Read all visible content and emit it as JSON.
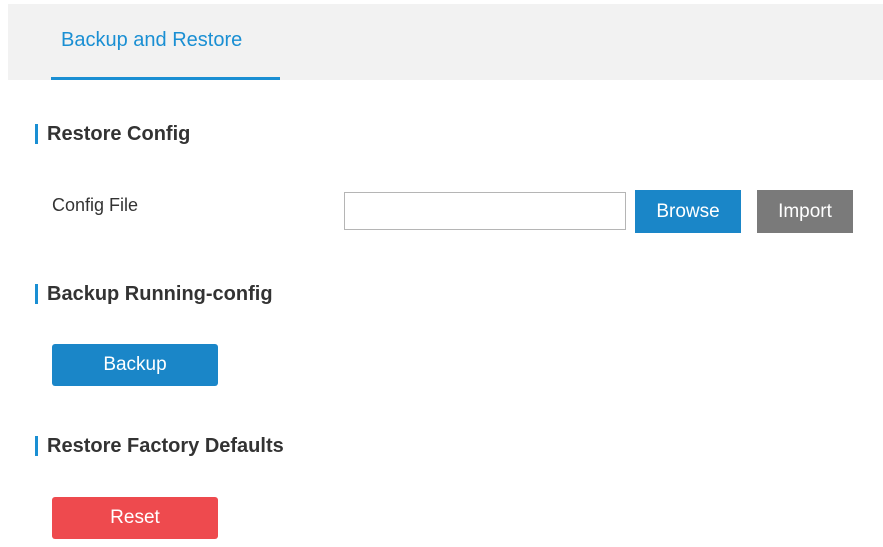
{
  "tabs": {
    "active_label": "Backup and Restore"
  },
  "restore_config": {
    "title": "Restore Config",
    "config_file_label": "Config File",
    "config_file_value": "",
    "browse_label": "Browse",
    "import_label": "Import"
  },
  "backup_running_config": {
    "title": "Backup Running-config",
    "backup_label": "Backup"
  },
  "restore_factory_defaults": {
    "title": "Restore Factory Defaults",
    "reset_label": "Reset"
  },
  "colors": {
    "accent": "#1a8fd3",
    "primary_button": "#1a86c8",
    "secondary_button": "#7a7a7a",
    "danger_button": "#ee4a4e",
    "tab_background": "#f2f2f2"
  }
}
